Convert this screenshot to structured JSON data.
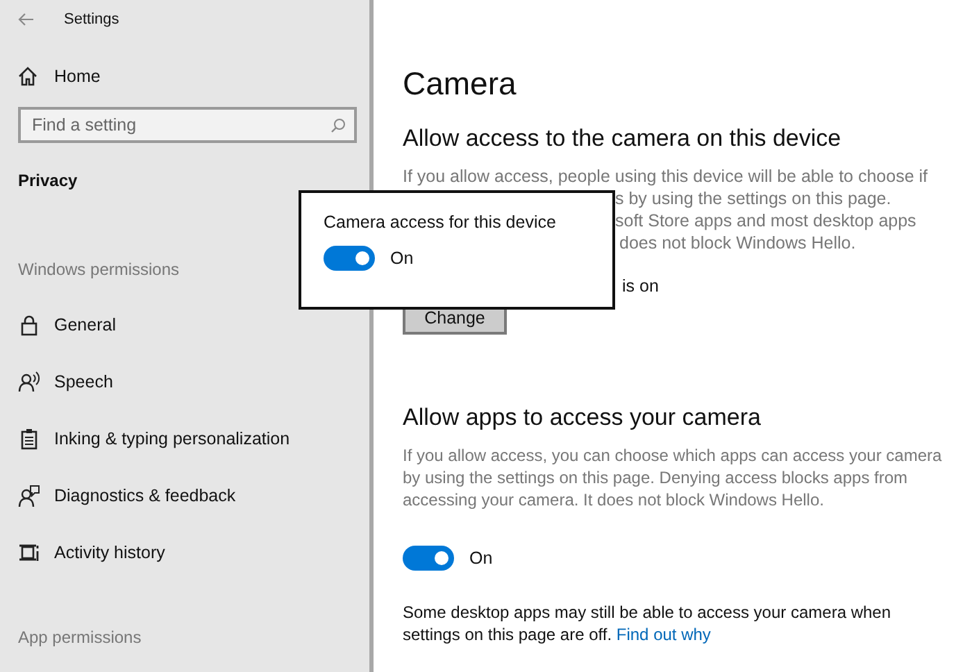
{
  "window": {
    "title": "Settings"
  },
  "sidebar": {
    "home": "Home",
    "search": {
      "placeholder": "Find a setting"
    },
    "current": "Privacy",
    "groups": [
      {
        "heading": "Windows permissions",
        "items": [
          {
            "label": "General"
          },
          {
            "label": "Speech"
          },
          {
            "label": "Inking & typing personalization"
          },
          {
            "label": "Diagnostics & feedback"
          },
          {
            "label": "Activity history"
          }
        ]
      },
      {
        "heading": "App permissions"
      }
    ]
  },
  "main": {
    "title": "Camera",
    "device_section": {
      "heading": "Allow access to the camera on this device",
      "description_lines": [
        "If you allow access, people using this device will be able to choose if",
        "s by using the settings on this page.",
        "soft Store apps and most desktop apps",
        "does not block Windows Hello."
      ],
      "status": "is on",
      "button": "Change"
    },
    "popup": {
      "title": "Camera access for this device",
      "toggle": {
        "on": true,
        "label": "On"
      }
    },
    "apps_section": {
      "heading": "Allow apps to access your camera",
      "description": "If you allow access, you can choose which apps can access your camera by using the settings on this page. Denying access blocks apps from accessing your camera. It does not block Windows Hello.",
      "toggle": {
        "on": true,
        "label": "On"
      },
      "note": "Some desktop apps may still be able to access your camera when settings on this page are off.",
      "link": "Find out why"
    }
  }
}
